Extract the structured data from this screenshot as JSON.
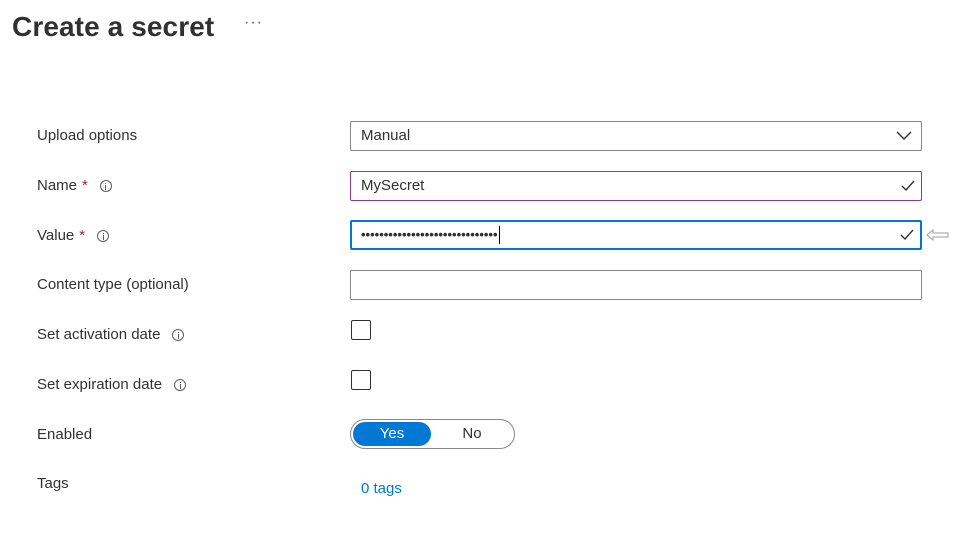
{
  "page": {
    "title": "Create a secret",
    "more_label": "···"
  },
  "form": {
    "upload_options": {
      "label": "Upload options",
      "value": "Manual"
    },
    "name": {
      "label": "Name",
      "required_mark": "*",
      "value": "MySecret"
    },
    "value": {
      "label": "Value",
      "required_mark": "*",
      "masked_value": "••••••••••••••••••••••••••••••"
    },
    "content_type": {
      "label": "Content type (optional)",
      "value": ""
    },
    "activation_date": {
      "label": "Set activation date",
      "checked": false
    },
    "expiration_date": {
      "label": "Set expiration date",
      "checked": false
    },
    "enabled": {
      "label": "Enabled",
      "yes_label": "Yes",
      "no_label": "No",
      "selected": "Yes"
    },
    "tags": {
      "label": "Tags",
      "link_text": "0 tags"
    }
  },
  "colors": {
    "accent": "#0078d4",
    "required": "#a4262c",
    "valid_field_border": "#8a3a95"
  },
  "icons": {
    "info": "info-icon",
    "check": "check-icon",
    "chevron": "chevron-down-icon",
    "arrow": "left-arrow-icon"
  }
}
